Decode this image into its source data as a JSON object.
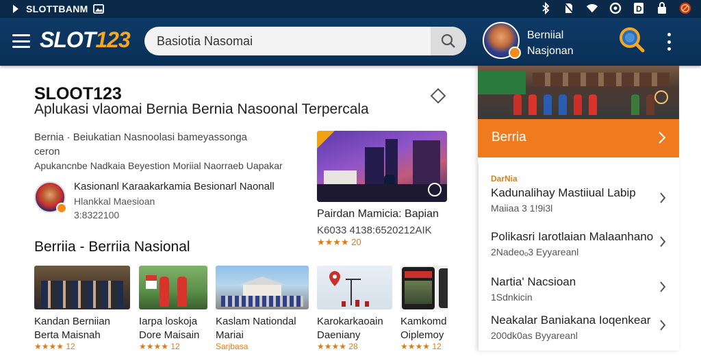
{
  "status_bar": {
    "app_name": "SLOTTBANM",
    "icons": [
      "bluetooth-icon",
      "no-sim-icon",
      "wifi-icon",
      "sync-icon",
      "d-badge-icon",
      "lock-icon",
      "notification-badge-icon"
    ]
  },
  "app_bar": {
    "logo_text": "SLOT",
    "logo_number": "123",
    "search_placeholder": "Basiotia Nasomai",
    "profile_name_line1": "Berniial",
    "profile_name_line2": "Nasjonan",
    "colors": {
      "bar": "#0d3a66",
      "accent": "#f5a623"
    }
  },
  "main": {
    "app_title": "SLOOT123",
    "app_subtitle": "Aplukasi ​vlaomai Bernia Bernia Nasoonal Terpercala",
    "description_line1": "Bernia · Beiukatian Nasnoolasi bameyassonga",
    "description_line2": "ceron",
    "description_line3": "Apukancnbe Nadkaia Beyestion Moriial Naorraeb Uapakar",
    "developer": {
      "name": "Kasionanl Karaakarkamia Besionarl Naonall",
      "meta_line1": "Hlankkal Maesioan",
      "meta_line2": "3:8322100"
    },
    "featured": {
      "title": "Pairdan Mamicia: Bapian",
      "meta": "K6033 4138:6520212AIK",
      "rating": "★★★★ 20"
    },
    "section_title": "Berriia - Berriia Nasional",
    "cards": [
      {
        "line1": "Kandan Berniian",
        "line2": "Berta Maisnah",
        "rating": "★★★★ 12"
      },
      {
        "line1": "Iarpa loskoja",
        "line2": "Dore Maisain",
        "rating": "★★★★ 12"
      },
      {
        "line1": "Kaslam Nationdal",
        "line2": "Mariai",
        "rating": "Sarjbasa"
      },
      {
        "line1": "Karokarkaoain",
        "line2": "Daeniany",
        "rating": "★★★★ 28"
      },
      {
        "line1": "Kamkomd",
        "line2": "Oiplemoy",
        "rating": "★★★★ 12"
      }
    ]
  },
  "panel": {
    "banner_label": "Berria",
    "list_tag": "DarNia",
    "items": [
      {
        "title": "Kadunalihay Mastiiual Labip",
        "sub": "Maiiaa 3 1!9i3l"
      },
      {
        "title": "Polikasri Iarotlaian Malaanhano",
        "sub": "2Nadeoₒ3 Eyyareanl"
      },
      {
        "title": "Nartia' Nacsioan",
        "sub": "1Sdnkicin"
      },
      {
        "title": "Neakalar Baniakana Ioqenkear",
        "sub": "200dk0as Byyareanl"
      }
    ],
    "colors": {
      "banner": "#f07a1e"
    }
  }
}
